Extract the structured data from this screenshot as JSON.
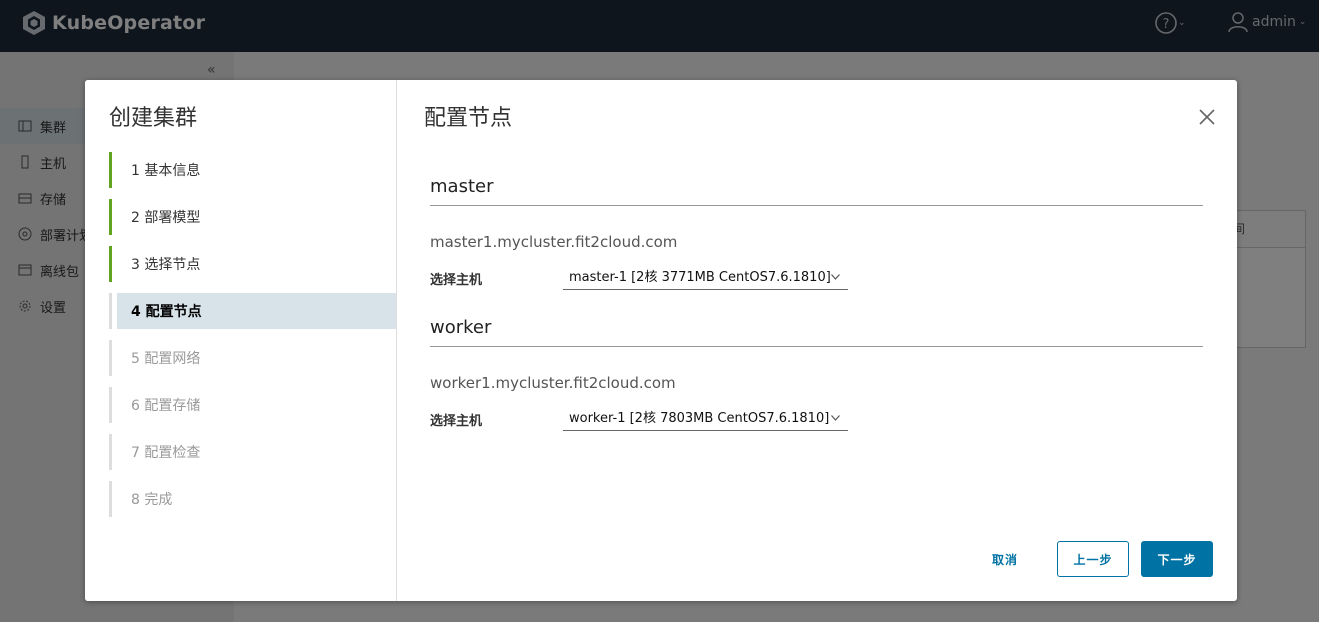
{
  "app": {
    "brand": "KubeOperator",
    "user": "admin"
  },
  "sidebar": {
    "items": [
      {
        "label": "集群",
        "icon": "cluster-icon",
        "active": true
      },
      {
        "label": "主机",
        "icon": "host-icon"
      },
      {
        "label": "存储",
        "icon": "storage-icon"
      },
      {
        "label": "部署计划",
        "icon": "deploy-plan-icon"
      },
      {
        "label": "离线包",
        "icon": "package-icon"
      },
      {
        "label": "设置",
        "icon": "settings-icon"
      }
    ]
  },
  "background_table": {
    "header_fragment": "间"
  },
  "wizard": {
    "title": "创建集群",
    "steps": [
      {
        "label": "1  基本信息",
        "state": "done"
      },
      {
        "label": "2  部署模型",
        "state": "done"
      },
      {
        "label": "3   选择节点",
        "state": "done"
      },
      {
        "label": "4  配置节点",
        "state": "current"
      },
      {
        "label": "5  配置网络",
        "state": "future"
      },
      {
        "label": "6  配置存储",
        "state": "future"
      },
      {
        "label": "7  配置检查",
        "state": "future"
      },
      {
        "label": "8  完成",
        "state": "future"
      }
    ],
    "page_title": "配置节点",
    "sections": [
      {
        "title": "master",
        "hostname": "master1.mycluster.fit2cloud.com",
        "field_label": "选择主机",
        "selected": "master-1 [2核 3771MB CentOS7.6.1810]"
      },
      {
        "title": "worker",
        "hostname": "worker1.mycluster.fit2cloud.com",
        "field_label": "选择主机",
        "selected": "worker-1 [2核 7803MB CentOS7.6.1810]"
      }
    ],
    "buttons": {
      "cancel": "取消",
      "prev": "上一步",
      "next": "下一步"
    }
  },
  "colors": {
    "header_bg": "#1e2b3a",
    "primary": "#0072a3",
    "step_done": "#62a420",
    "step_current_bg": "#d8e3e9"
  }
}
